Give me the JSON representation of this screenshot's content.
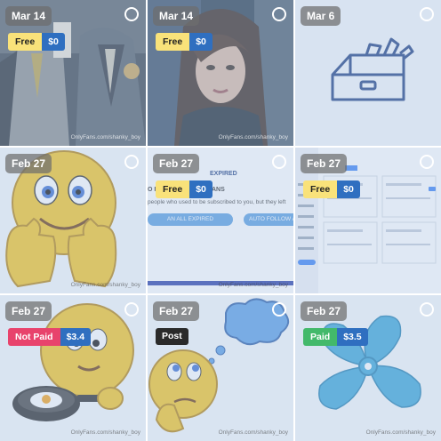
{
  "tiles": [
    {
      "date": "Mar 14",
      "badge": {
        "type": "free",
        "label": "Free",
        "price": "$0"
      },
      "watermark": "OnlyFans.com/shanky_boy"
    },
    {
      "date": "Mar 14",
      "badge": {
        "type": "free",
        "label": "Free",
        "price": "$0"
      },
      "watermark": "OnlyFans.com/shanky_boy"
    },
    {
      "date": "Mar 6",
      "watermark": ""
    },
    {
      "date": "Feb 27",
      "watermark": "OnlyFans.com/shanky_boy"
    },
    {
      "date": "Feb 27",
      "badge": {
        "type": "free",
        "label": "Free",
        "price": "$0"
      },
      "watermark": "OnlyFans.com/shanky_boy",
      "screen_text": {
        "expired": "EXPIRED",
        "heading": "O RENEW EXPIRED FANS",
        "body": "people who used to be subscribed to you, but they left",
        "btn_left": "AN ALL EXPIRED",
        "btn_right": "AUTO FOLLOW A"
      }
    },
    {
      "date": "Feb 27",
      "badge": {
        "type": "free",
        "label": "Free",
        "price": "$0"
      },
      "watermark": ""
    },
    {
      "date": "Feb 27",
      "badge": {
        "type": "notpaid",
        "label": "Not Paid",
        "price": "$3.4"
      },
      "watermark": "OnlyFans.com/shanky_boy"
    },
    {
      "date": "Feb 27",
      "post_label": "Post",
      "watermark": "OnlyFans.com/shanky_boy"
    },
    {
      "date": "Feb 27",
      "badge": {
        "type": "paid",
        "label": "Paid",
        "price": "$3.5"
      },
      "watermark": "OnlyFans.com/shanky_boy"
    }
  ],
  "colors": {
    "free": "#f9e27a",
    "notpaid": "#e8436c",
    "paid": "#43b96b",
    "price": "#2f6fc0",
    "post": "#2a2a2a"
  }
}
